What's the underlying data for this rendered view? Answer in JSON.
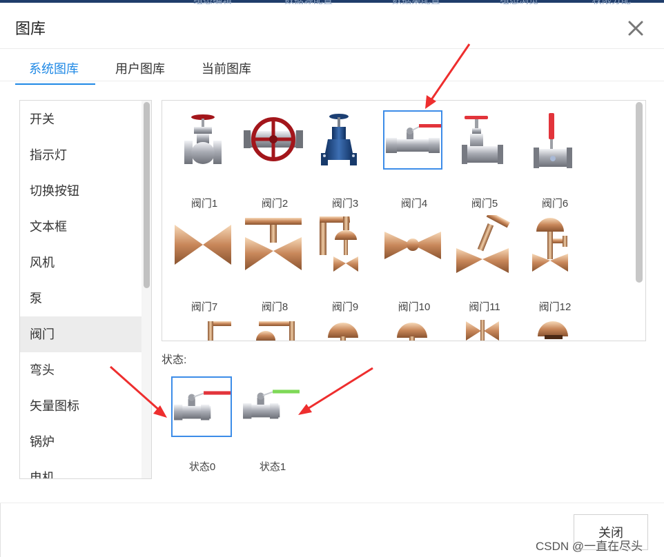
{
  "background_nav": [
    "组态编辑",
    "数据源配置",
    "数据集配置",
    "组态浏览",
    "权限分配"
  ],
  "dialog": {
    "title": "图库",
    "close_label": "关闭"
  },
  "tabs": [
    {
      "label": "系统图库",
      "active": true
    },
    {
      "label": "用户图库",
      "active": false
    },
    {
      "label": "当前图库",
      "active": false
    }
  ],
  "categories": [
    "开关",
    "指示灯",
    "切换按钮",
    "文本框",
    "风机",
    "泵",
    "阀门",
    "弯头",
    "矢量图标",
    "锅炉",
    "电机"
  ],
  "active_category": "阀门",
  "gallery": {
    "items": [
      {
        "label": "阀门1",
        "icon": "globe-valve-icon",
        "selected": false
      },
      {
        "label": "阀门2",
        "icon": "wheel-valve-icon",
        "selected": false
      },
      {
        "label": "阀门3",
        "icon": "gate-valve-icon",
        "selected": false
      },
      {
        "label": "阀门4",
        "icon": "ball-valve-icon",
        "selected": true
      },
      {
        "label": "阀门5",
        "icon": "red-handwheel-valve-icon",
        "selected": false
      },
      {
        "label": "阀门6",
        "icon": "lever-valve-icon",
        "selected": false
      },
      {
        "label": "阀门7",
        "icon": "bowtie-valve-icon",
        "selected": false
      },
      {
        "label": "阀门8",
        "icon": "t-stem-valve-icon",
        "selected": false
      },
      {
        "label": "阀门9",
        "icon": "elbow-dome-valve-icon",
        "selected": false
      },
      {
        "label": "阀门10",
        "icon": "ball-bowtie-valve-icon",
        "selected": false
      },
      {
        "label": "阀门11",
        "icon": "angled-stem-valve-icon",
        "selected": false
      },
      {
        "label": "阀门12",
        "icon": "dome-actuator-valve-icon",
        "selected": false
      }
    ]
  },
  "states": {
    "title": "状态:",
    "items": [
      {
        "label": "状态0",
        "handle_color": "#e2343b",
        "selected": true
      },
      {
        "label": "状态1",
        "handle_color": "#7ed957",
        "selected": false
      }
    ]
  },
  "watermark": "CSDN @一直在尽头"
}
